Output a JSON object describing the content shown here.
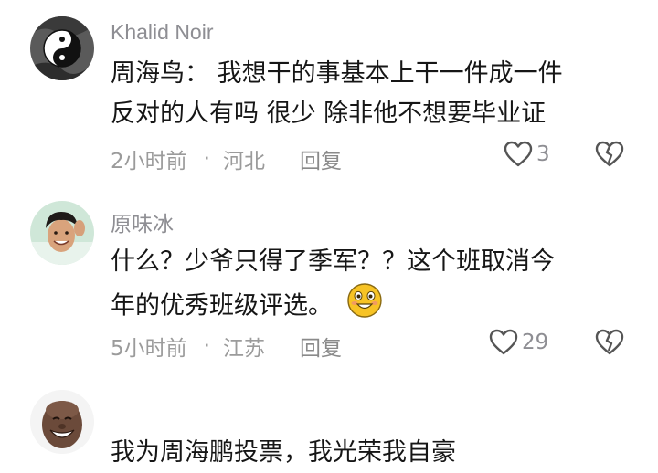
{
  "comments": [
    {
      "username": "Khalid Noir",
      "avatar_icon": "yin-yang-dragon-avatar",
      "text_lines": [
        "周海鸟：  我想干的事基本上干一件成一件",
        "反对的人有吗 很少 除非他不想要毕业证"
      ],
      "time": "2小时前",
      "location": "河北",
      "reply_label": "回复",
      "likes": "3"
    },
    {
      "username": "原味冰",
      "avatar_icon": "smiling-boy-avatar",
      "text_lines": [
        "什么？少爷只得了季军？？这个班取消今",
        "年的优秀班级评选。"
      ],
      "emoji": "grinning-emoji",
      "time": "5小时前",
      "location": "江苏",
      "reply_label": "回复",
      "likes": "29"
    },
    {
      "username": "",
      "avatar_icon": "laughing-man-avatar",
      "text_lines": [
        "我为周海鹏投票，我光荣我自豪"
      ]
    }
  ],
  "icons": {
    "like": "heart-icon",
    "dislike": "broken-heart-icon"
  },
  "colors": {
    "text": "#161616",
    "muted": "#8e8e93",
    "emoji_yellow": "#f7c325"
  }
}
